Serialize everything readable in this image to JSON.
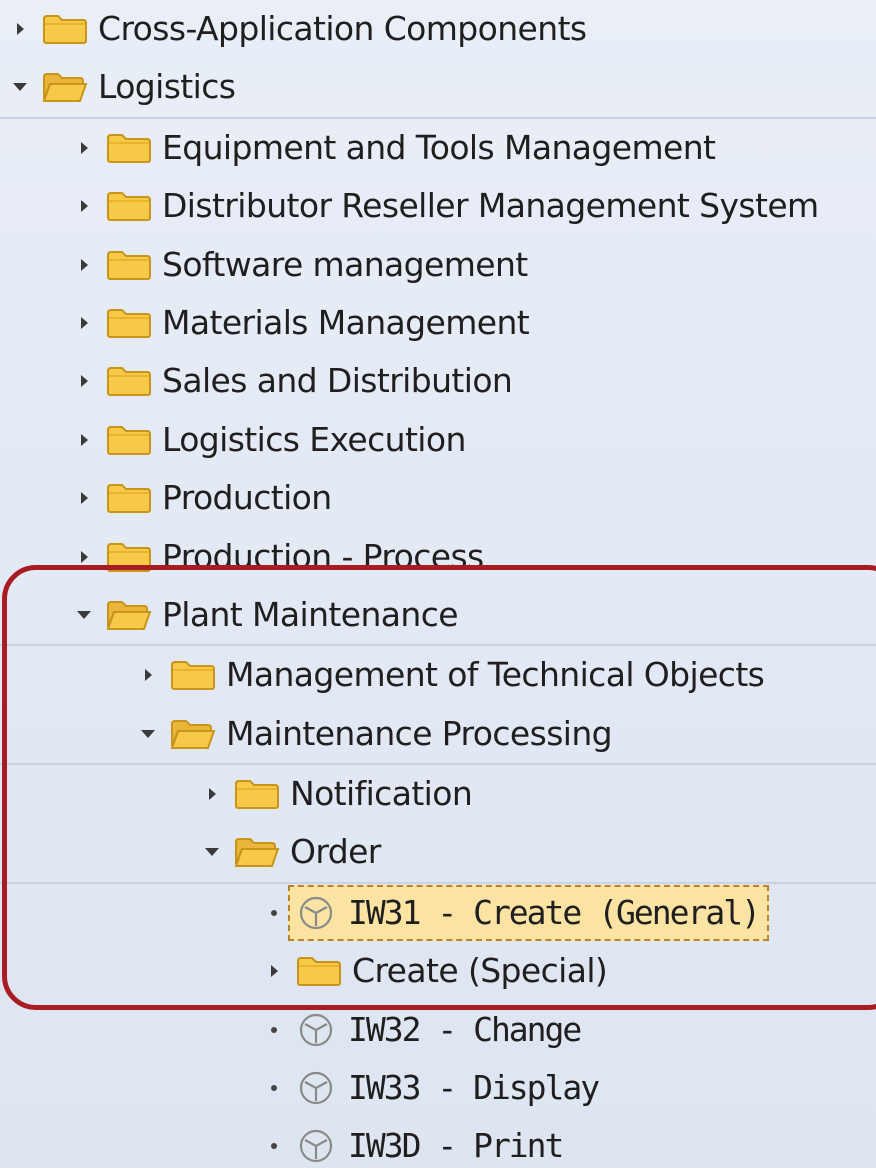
{
  "colors": {
    "folder_fill": "#f6c948",
    "folder_stroke": "#c9941a",
    "highlight_frame": "#a81c24",
    "selection_fill": "#fbe3a3"
  },
  "tree": {
    "items": [
      {
        "label": "Cross-Application Components",
        "icon": "folder-closed-icon",
        "expander": "triangle-right-icon"
      },
      {
        "label": "Logistics",
        "icon": "folder-open-icon",
        "expander": "triangle-down-icon"
      },
      {
        "label": "Equipment and Tools Management",
        "icon": "folder-closed-icon",
        "expander": "triangle-right-icon"
      },
      {
        "label": "Distributor Reseller Management System",
        "icon": "folder-closed-icon",
        "expander": "triangle-right-icon"
      },
      {
        "label": "Software management",
        "icon": "folder-closed-icon",
        "expander": "triangle-right-icon"
      },
      {
        "label": "Materials Management",
        "icon": "folder-closed-icon",
        "expander": "triangle-right-icon"
      },
      {
        "label": "Sales and Distribution",
        "icon": "folder-closed-icon",
        "expander": "triangle-right-icon"
      },
      {
        "label": "Logistics Execution",
        "icon": "folder-closed-icon",
        "expander": "triangle-right-icon"
      },
      {
        "label": "Production",
        "icon": "folder-closed-icon",
        "expander": "triangle-right-icon"
      },
      {
        "label": "Production - Process",
        "icon": "folder-closed-icon",
        "expander": "triangle-right-icon"
      },
      {
        "label": "Plant Maintenance",
        "icon": "folder-open-icon",
        "expander": "triangle-down-icon"
      },
      {
        "label": "Management of Technical Objects",
        "icon": "folder-closed-icon",
        "expander": "triangle-right-icon"
      },
      {
        "label": "Maintenance Processing",
        "icon": "folder-open-icon",
        "expander": "triangle-down-icon"
      },
      {
        "label": "Notification",
        "icon": "folder-closed-icon",
        "expander": "triangle-right-icon"
      },
      {
        "label": "Order",
        "icon": "folder-open-icon",
        "expander": "triangle-down-icon"
      },
      {
        "label": "IW31 - Create (General)",
        "icon": "transaction-cube-icon",
        "expander": "bullet",
        "selected": true
      },
      {
        "label": "Create (Special)",
        "icon": "folder-closed-icon",
        "expander": "triangle-right-icon"
      },
      {
        "label": "IW32 - Change",
        "icon": "transaction-cube-icon",
        "expander": "bullet"
      },
      {
        "label": "IW33 - Display",
        "icon": "transaction-cube-icon",
        "expander": "bullet"
      },
      {
        "label": "IW3D - Print",
        "icon": "transaction-cube-icon",
        "expander": "bullet"
      }
    ]
  }
}
